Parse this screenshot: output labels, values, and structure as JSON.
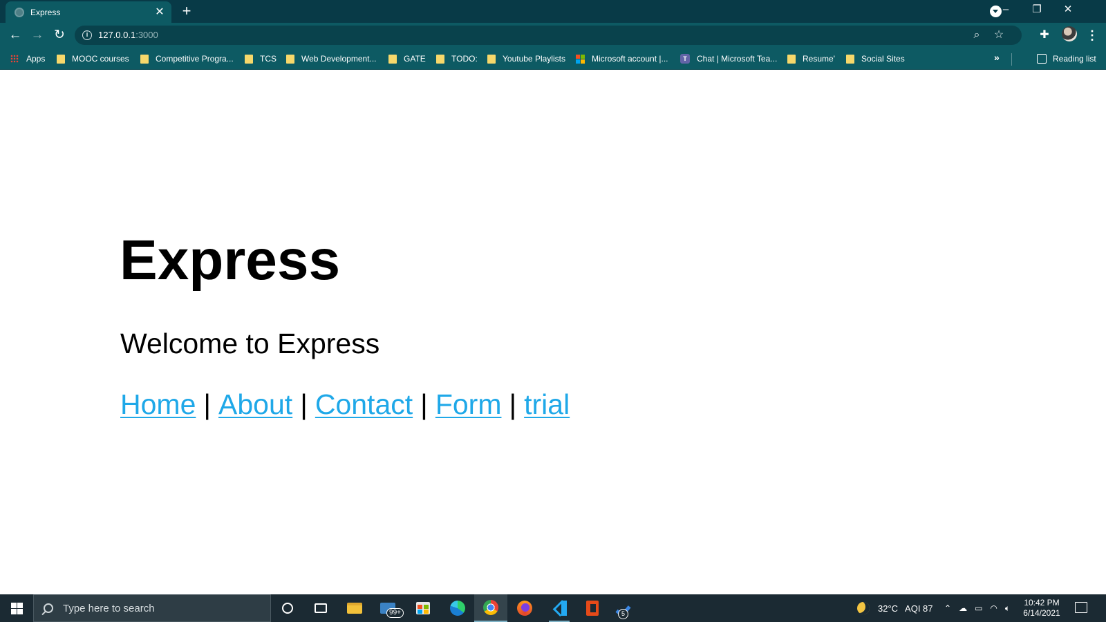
{
  "browser": {
    "tab_title": "Express",
    "new_tab": "+",
    "url_host": "127.0.0.1",
    "url_port": ":3000",
    "window_controls": [
      "–",
      "❐",
      "✕"
    ]
  },
  "bookmarks": [
    {
      "label": "Apps",
      "icon": "apps-grid-icon"
    },
    {
      "label": "MOOC courses",
      "icon": "folder-icon"
    },
    {
      "label": "Competitive Progra...",
      "icon": "folder-icon"
    },
    {
      "label": "TCS",
      "icon": "folder-icon"
    },
    {
      "label": "Web Development...",
      "icon": "folder-icon"
    },
    {
      "label": "GATE",
      "icon": "folder-icon"
    },
    {
      "label": "TODO:",
      "icon": "folder-icon"
    },
    {
      "label": "Youtube Playlists",
      "icon": "folder-icon"
    },
    {
      "label": "Microsoft account |...",
      "icon": "microsoft-icon"
    },
    {
      "label": "Chat | Microsoft Tea...",
      "icon": "teams-icon"
    },
    {
      "label": "Resume'",
      "icon": "folder-icon"
    },
    {
      "label": "Social Sites",
      "icon": "folder-icon"
    }
  ],
  "bookmarks_more": "»",
  "reading_list": "Reading list",
  "page": {
    "title": "Express",
    "welcome": "Welcome to Express",
    "nav": [
      "Home",
      "About",
      "Contact",
      "Form",
      "trial"
    ],
    "separator": "|"
  },
  "taskbar": {
    "search_placeholder": "Type here to search",
    "mail_badge": "99+",
    "todo_badge": "5",
    "weather": "32°C",
    "aqi": "AQI 87",
    "time": "10:42 PM",
    "date": "6/14/2021"
  },
  "colors": {
    "chrome_frame": "#083a47",
    "chrome_toolbar": "#0d5a63",
    "link": "#1fa8e8",
    "taskbar": "#1b2a33"
  }
}
